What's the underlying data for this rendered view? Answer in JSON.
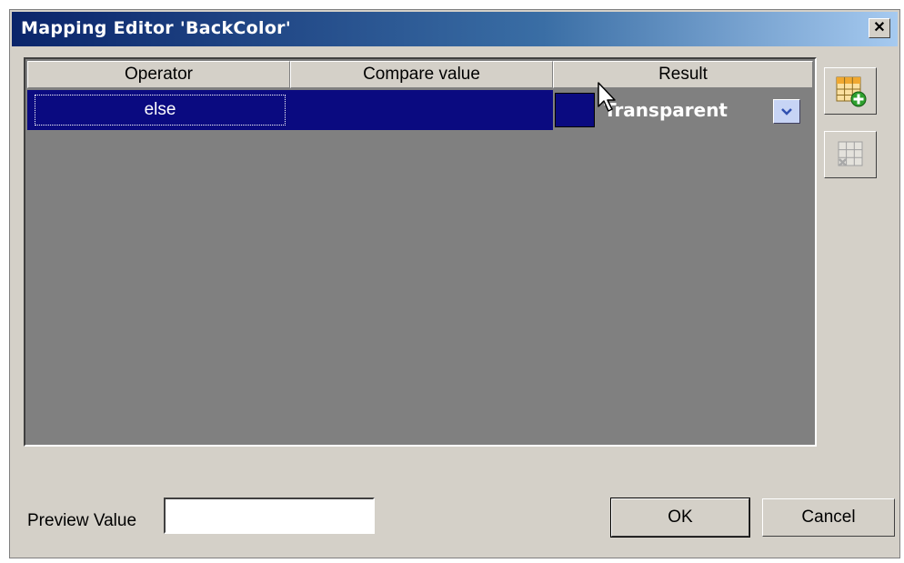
{
  "window": {
    "title": "Mapping Editor 'BackColor'",
    "close_label": "✕"
  },
  "grid": {
    "columns": [
      "Operator",
      "Compare value",
      "Result"
    ],
    "rows": [
      {
        "operator": "else",
        "compare_value": "",
        "result": "Transparent"
      }
    ]
  },
  "preview": {
    "label": "Preview Value",
    "value": ""
  },
  "buttons": {
    "ok": "OK",
    "cancel": "Cancel"
  },
  "icons": {
    "add_row": "add-row-icon",
    "delete_row": "delete-row-icon",
    "dropdown": "chevron-down-icon",
    "close": "close-icon",
    "cursor": "mouse-pointer-icon"
  },
  "colors": {
    "title_bar_start": "#0a246a",
    "selection": "#0a0a80",
    "grid_background": "#808080",
    "dialog_face": "#d4d0c8"
  }
}
